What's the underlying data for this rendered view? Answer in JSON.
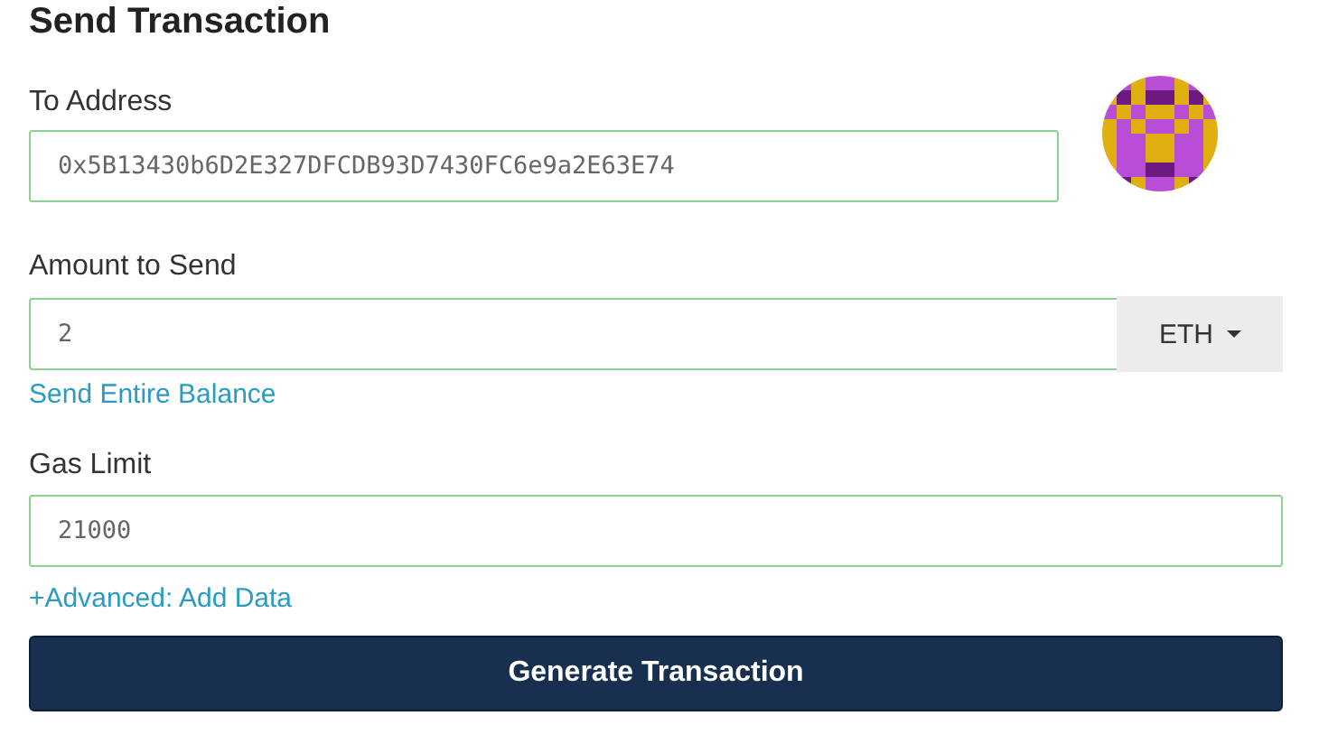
{
  "title": "Send Transaction",
  "to_address": {
    "label": "To Address",
    "value": "0x5B13430b6D2E327DFCDB93D7430FC6e9a2E63E74"
  },
  "amount": {
    "label": "Amount to Send",
    "value": "2",
    "currency": "ETH",
    "link": "Send Entire Balance"
  },
  "gas_limit": {
    "label": "Gas Limit",
    "value": "21000"
  },
  "advanced_link": "+Advanced: Add Data",
  "submit_button": "Generate Transaction"
}
